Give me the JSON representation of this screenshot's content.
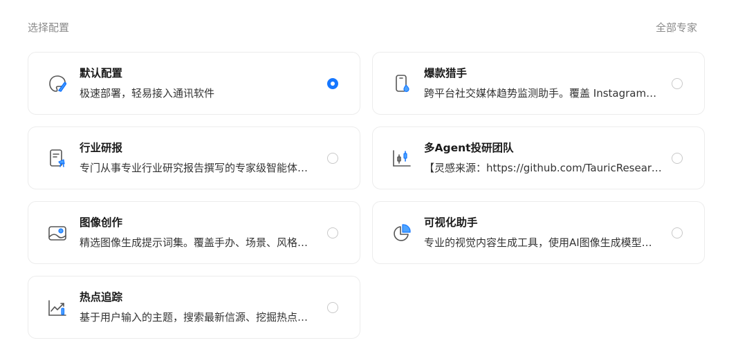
{
  "header": {
    "title": "选择配置",
    "all_experts": "全部专家"
  },
  "cards": [
    {
      "name": "默认配置",
      "desc": "极速部署，轻易接入通讯软件",
      "icon": "palette-icon",
      "selected": true
    },
    {
      "name": "爆款猎手",
      "desc": "跨平台社交媒体趋势监测助手。覆盖 Instagram…",
      "icon": "phone-icon",
      "selected": false
    },
    {
      "name": "行业研报",
      "desc": "专门从事专业行业研究报告撰写的专家级智能体…",
      "icon": "report-icon",
      "selected": false
    },
    {
      "name": "多Agent投研团队",
      "desc": "【灵感来源：https://github.com/TauricResearch】",
      "icon": "candlestick-icon",
      "selected": false
    },
    {
      "name": "图像创作",
      "desc": "精选图像生成提示词集。覆盖手办、场景、风格…",
      "icon": "image-icon",
      "selected": false
    },
    {
      "name": "可视化助手",
      "desc": "专业的视觉内容生成工具，使用AI图像生成模型…",
      "icon": "pie-chart-icon",
      "selected": false
    },
    {
      "name": "热点追踪",
      "desc": "基于用户输入的主题，搜索最新信源、挖掘热点…",
      "icon": "trend-icon",
      "selected": false
    }
  ],
  "colors": {
    "accent": "#1677ff",
    "icon_stroke": "#555555",
    "border": "#ececec"
  }
}
